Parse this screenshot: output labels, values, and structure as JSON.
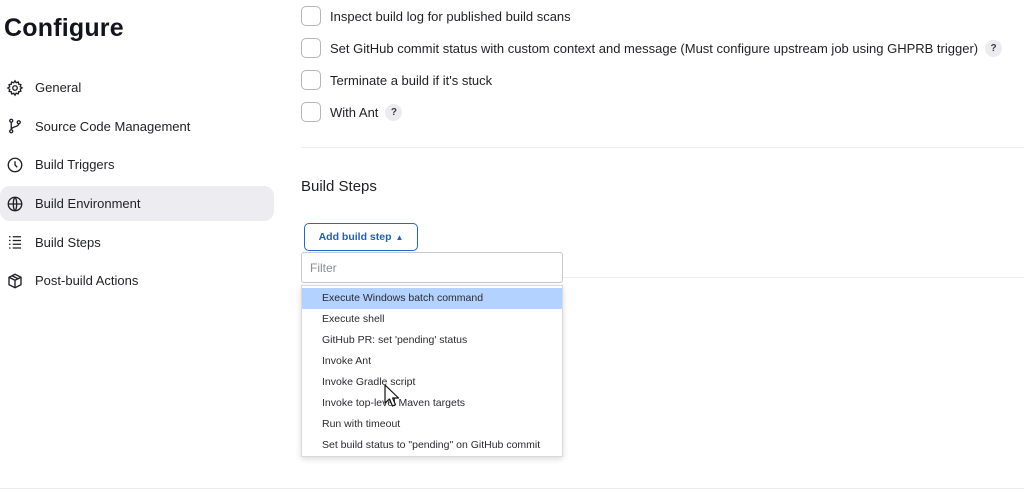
{
  "page": {
    "title": "Configure"
  },
  "sidebar": {
    "items": [
      {
        "label": "General",
        "icon": "gear-icon",
        "active": false
      },
      {
        "label": "Source Code Management",
        "icon": "branch-icon",
        "active": false
      },
      {
        "label": "Build Triggers",
        "icon": "clock-icon",
        "active": false
      },
      {
        "label": "Build Environment",
        "icon": "globe-icon",
        "active": true
      },
      {
        "label": "Build Steps",
        "icon": "list-icon",
        "active": false
      },
      {
        "label": "Post-build Actions",
        "icon": "package-icon",
        "active": false
      }
    ]
  },
  "options": [
    {
      "label": "Inspect build log for published build scans",
      "checked": false,
      "help": false
    },
    {
      "label": "Set GitHub commit status with custom context and message (Must configure upstream job using GHPRB trigger)",
      "checked": false,
      "help": true
    },
    {
      "label": "Terminate a build if it's stuck",
      "checked": false,
      "help": false
    },
    {
      "label": "With Ant",
      "checked": false,
      "help": true
    }
  ],
  "help_label": "?",
  "build_steps": {
    "title": "Build Steps",
    "add_button_label": "Add build step",
    "filter_placeholder": "Filter",
    "filter_value": "",
    "menu_items": [
      "Execute Windows batch command",
      "Execute shell",
      "GitHub PR: set 'pending' status",
      "Invoke Ant",
      "Invoke Gradle script",
      "Invoke top-level Maven targets",
      "Run with timeout",
      "Set build status to \"pending\" on GitHub commit"
    ],
    "highlighted_item": "Execute Windows batch command"
  },
  "colors": {
    "accent": "#1f6ad1",
    "highlight": "#b3d2ff",
    "sidebar_active": "#ececf1"
  }
}
